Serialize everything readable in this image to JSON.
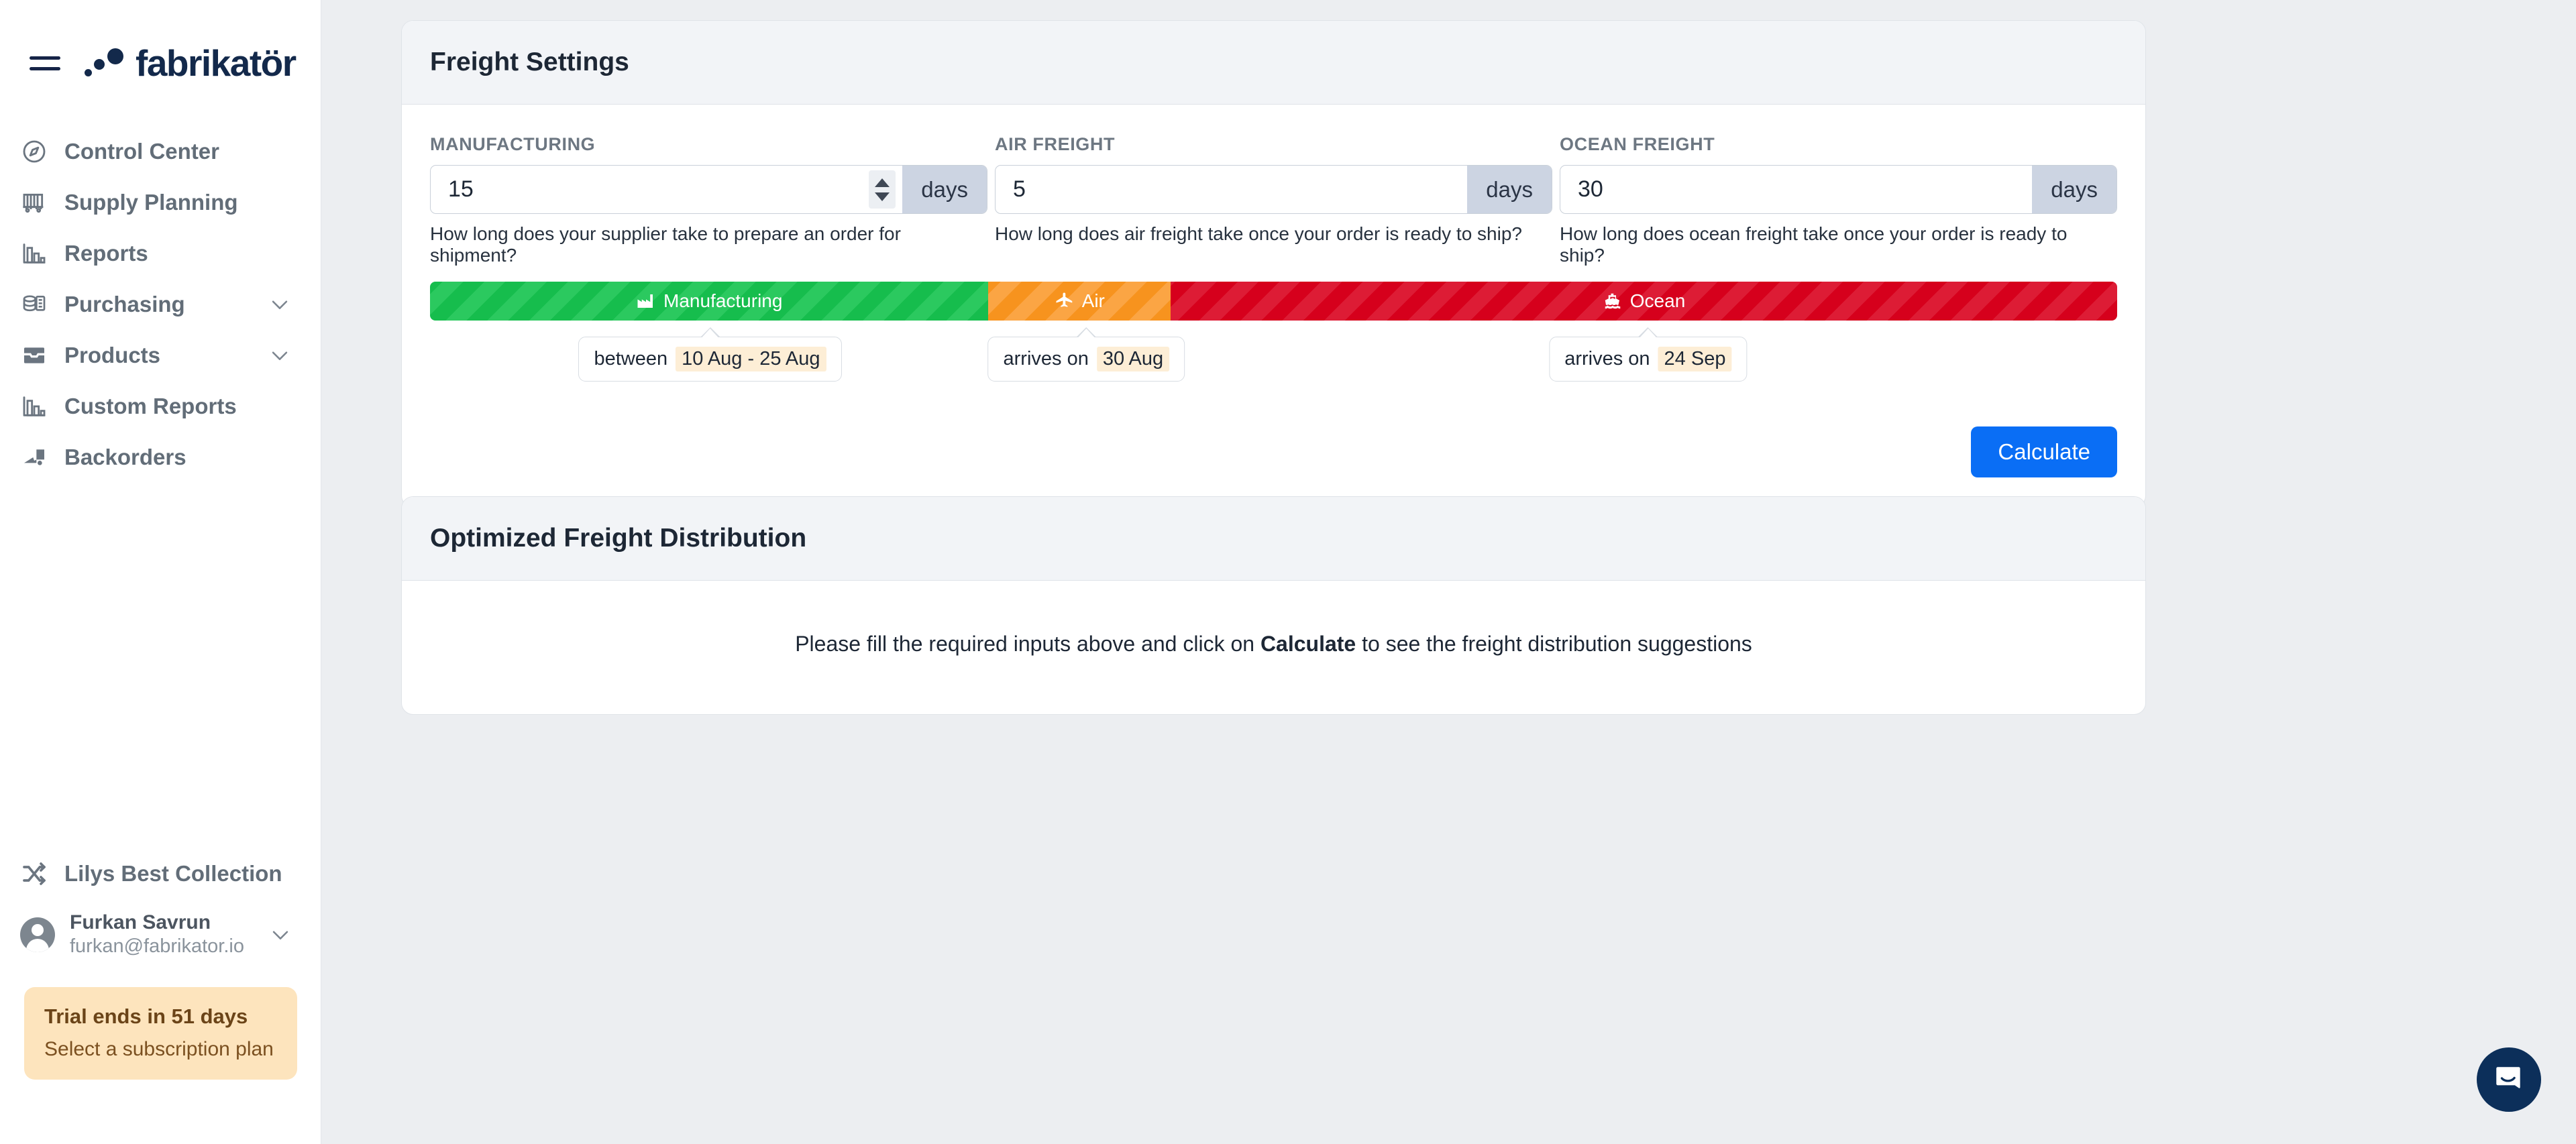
{
  "brand": {
    "name": "fabrikatör",
    "mark_icon": "fabrikator-dots-logo",
    "menu_icon": "hamburger-menu-icon"
  },
  "sidebar": {
    "items": [
      {
        "label": "Control Center",
        "icon": "compass-icon",
        "expandable": false
      },
      {
        "label": "Supply Planning",
        "icon": "container-icon",
        "expandable": false
      },
      {
        "label": "Reports",
        "icon": "bar-chart-icon",
        "expandable": false
      },
      {
        "label": "Purchasing",
        "icon": "coins-stack-icon",
        "expandable": true
      },
      {
        "label": "Products",
        "icon": "inbox-tray-icon",
        "expandable": true
      },
      {
        "label": "Custom Reports",
        "icon": "bar-chart-icon",
        "expandable": false
      },
      {
        "label": "Backorders",
        "icon": "delivery-truck-icon",
        "expandable": false
      }
    ],
    "collection": {
      "label": "Lilys Best Collection",
      "icon": "shuffle-icon"
    },
    "user": {
      "name": "Furkan Savrun",
      "email": "furkan@fabrikator.io",
      "avatar_icon": "user-avatar",
      "chevron_icon": "chevron-down-icon"
    },
    "trial": {
      "title": "Trial ends in 51 days",
      "link": "Select a subscription plan"
    }
  },
  "freight_settings": {
    "title": "Freight Settings",
    "fields": [
      {
        "label": "MANUFACTURING",
        "value": "15",
        "placeholder": "0",
        "unit": "days",
        "hint": "How long does your supplier take to prepare an order for shipment?",
        "has_spinner": true
      },
      {
        "label": "AIR FREIGHT",
        "value": "5",
        "placeholder": "0",
        "unit": "days",
        "hint": "How long does air freight take once your order is ready to ship?",
        "has_spinner": false
      },
      {
        "label": "OCEAN FREIGHT",
        "value": "30",
        "placeholder": "0",
        "unit": "days",
        "hint": "How long does ocean freight take once your order is ready to ship?",
        "has_spinner": false
      }
    ],
    "timeline": {
      "segments": [
        {
          "label": "Manufacturing",
          "icon": "factory-icon",
          "color": "#16bd4d",
          "stripe": "#2bc95f",
          "percent": 33.1
        },
        {
          "label": "Air",
          "icon": "airplane-icon",
          "color": "#f7931e",
          "stripe": "#fba544",
          "percent": 10.8
        },
        {
          "label": "Ocean",
          "icon": "ship-icon",
          "color": "#d6001c",
          "stripe": "#dd1c35",
          "percent": 56.1
        }
      ],
      "tooltips": [
        {
          "prefix": "between",
          "value": "10 Aug - 25 Aug",
          "center_percent": 16.6
        },
        {
          "prefix": "arrives on",
          "value": "30 Aug",
          "center_percent": 38.9
        },
        {
          "prefix": "arrives on",
          "value": "24 Sep",
          "center_percent": 72.2
        }
      ]
    },
    "calculate_label": "Calculate"
  },
  "distribution": {
    "title": "Optimized Freight Distribution",
    "empty_prefix": "Please fill the required inputs above and click on ",
    "empty_bold": "Calculate",
    "empty_suffix": " to see the freight distribution suggestions"
  },
  "intercom": {
    "icon": "chat-bubble-icon"
  },
  "colors": {
    "accent": "#0a6ef5",
    "brand_navy": "#13294b",
    "trial_bg": "#fde4bd",
    "highlight": "#fdeed6"
  }
}
